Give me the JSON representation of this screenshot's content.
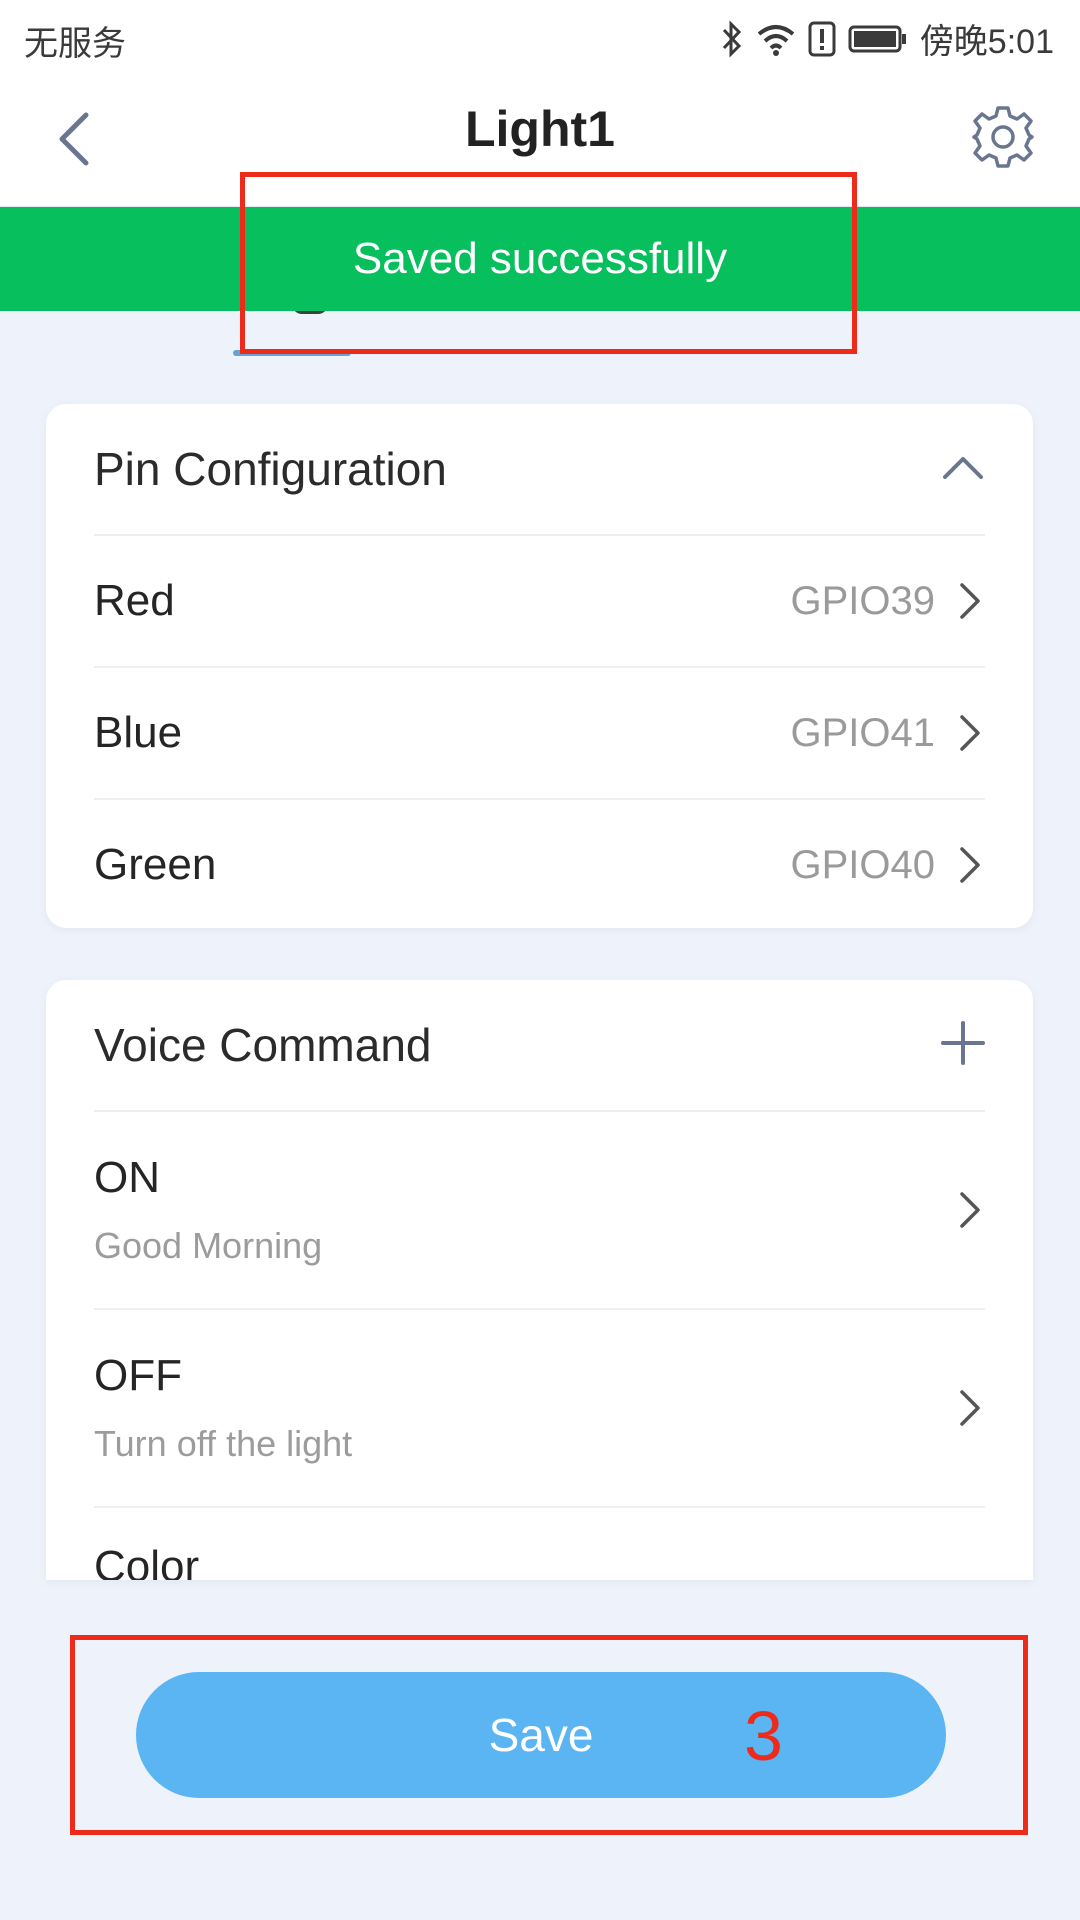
{
  "status_bar": {
    "carrier": "无服务",
    "time": "傍晚5:01",
    "icons": [
      "bluetooth-icon",
      "wifi-icon",
      "alert-icon",
      "battery-icon"
    ]
  },
  "header": {
    "title": "Light1",
    "back_icon": "chevron-left-icon",
    "settings_icon": "gear-icon"
  },
  "toast": {
    "message": "Saved successfully"
  },
  "pin_config": {
    "title": "Pin Configuration",
    "toggle_icon": "chevron-up-icon",
    "rows": [
      {
        "label": "Red",
        "value": "GPIO39"
      },
      {
        "label": "Blue",
        "value": "GPIO41"
      },
      {
        "label": "Green",
        "value": "GPIO40"
      }
    ]
  },
  "voice_command": {
    "title": "Voice Command",
    "add_icon": "plus-icon",
    "rows": [
      {
        "label": "ON",
        "phrase": "Good Morning"
      },
      {
        "label": "OFF",
        "phrase": "Turn off the light"
      },
      {
        "label": "Color",
        "phrase": ""
      }
    ]
  },
  "save_button": {
    "label": "Save"
  },
  "annotation": {
    "step_number": "3"
  },
  "colors": {
    "toast_green": "#08bf5e",
    "save_blue": "#5bb5f2",
    "annotation_red": "#ee2a1b",
    "background": "#eef2fb"
  }
}
